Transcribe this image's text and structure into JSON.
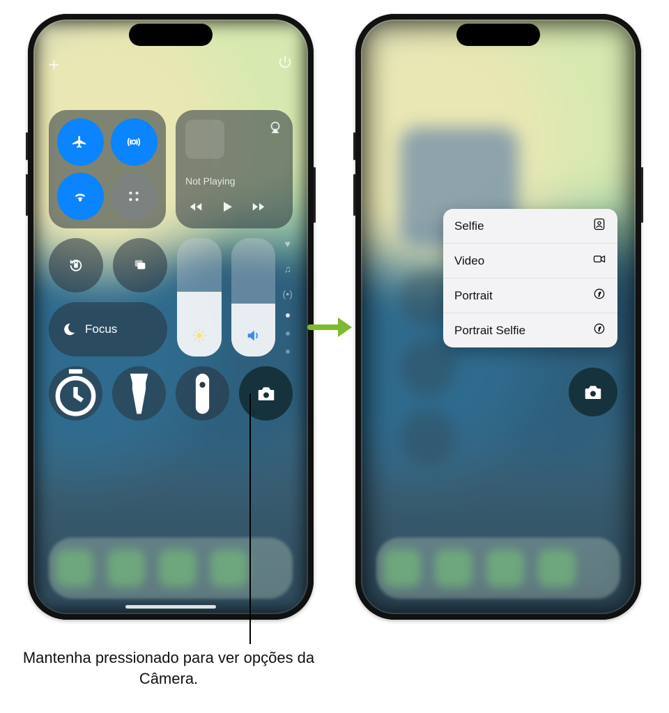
{
  "left_phone": {
    "top": {
      "add": "+",
      "power": "⏻"
    },
    "media": {
      "not_playing": "Not Playing"
    },
    "focus": {
      "label": "Focus"
    },
    "shortcuts": {
      "timer": "timer",
      "flashlight": "flashlight",
      "remote": "remote",
      "camera": "camera"
    }
  },
  "right_phone": {
    "context_menu": [
      {
        "label": "Selfie",
        "icon": "selfie"
      },
      {
        "label": "Video",
        "icon": "video"
      },
      {
        "label": "Portrait",
        "icon": "portrait"
      },
      {
        "label": "Portrait Selfie",
        "icon": "portrait"
      }
    ]
  },
  "caption": "Mantenha pressionado para ver opções da Câmera."
}
